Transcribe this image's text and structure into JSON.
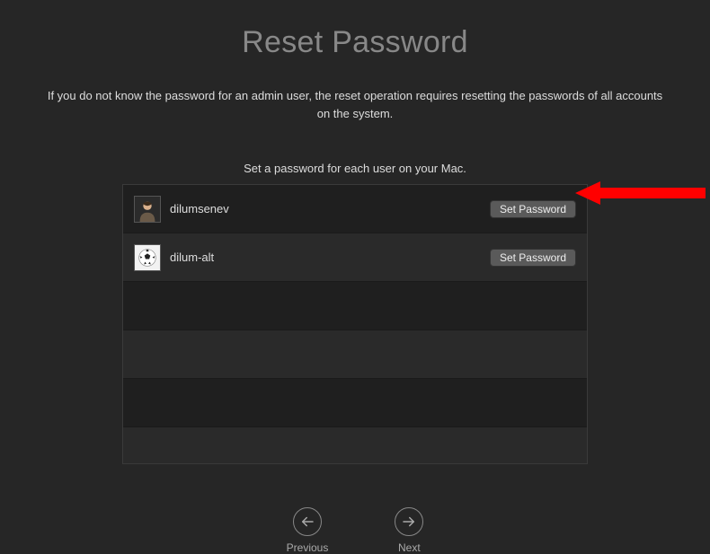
{
  "header": {
    "title": "Reset Password",
    "subtitle": "If you do not know the password for an admin user, the reset operation requires resetting the passwords of all accounts on the system.",
    "instruction": "Set a password for each user on your Mac."
  },
  "users": [
    {
      "name": "dilumsenev",
      "avatar_kind": "portrait",
      "button_label": "Set Password",
      "selected": true
    },
    {
      "name": "dilum-alt",
      "avatar_kind": "soccer",
      "button_label": "Set Password",
      "selected": false
    }
  ],
  "nav": {
    "previous_label": "Previous",
    "next_label": "Next"
  },
  "annotation": {
    "points_to": "set-password-button-0"
  }
}
